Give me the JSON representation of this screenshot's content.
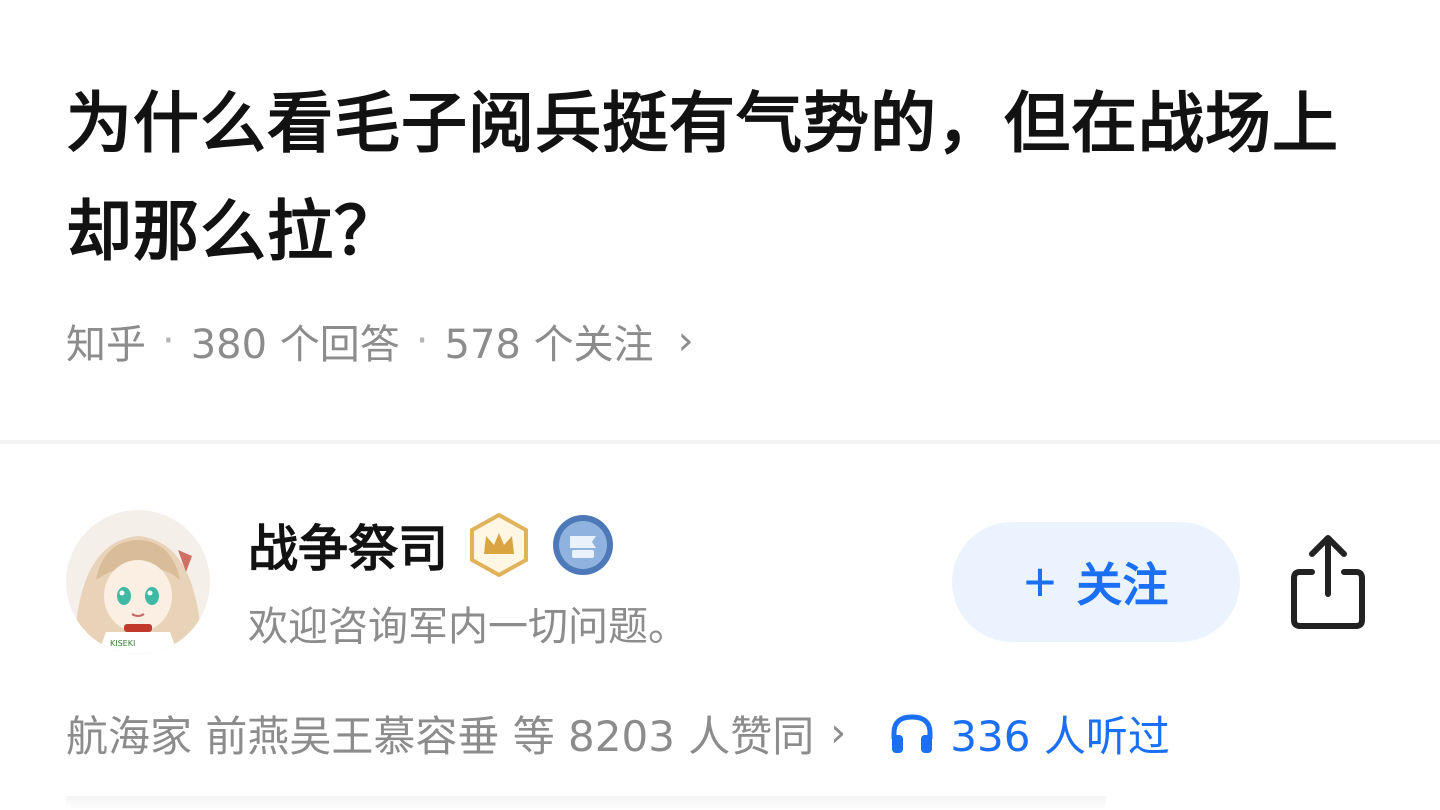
{
  "question": {
    "title": "为什么看毛子阅兵挺有气势的，但在战场上却那么拉？",
    "source": "知乎",
    "dot1": "·",
    "answers_count": "380 个回答",
    "dot2": "·",
    "followers_count": "578 个关注",
    "chevron": "›"
  },
  "author": {
    "name": "战争祭司",
    "bio": "欢迎咨询军内一切问题。",
    "badges": [
      "crown-badge-icon",
      "honor-badge-icon"
    ],
    "follow_label": "关注",
    "follow_plus": "+",
    "share_icon": "share-icon"
  },
  "stats": {
    "voters_text": "航海家 前燕吴王慕容垂 等 8203 人赞同",
    "voters_chevron": "›",
    "listens_text": "336 人听过",
    "listens_icon": "headphones-icon"
  },
  "colors": {
    "accent": "#1a6ff5",
    "follow_bg": "#ebf3ff",
    "muted_text": "#8c8c8c",
    "badge_gold": "#d9a441"
  }
}
